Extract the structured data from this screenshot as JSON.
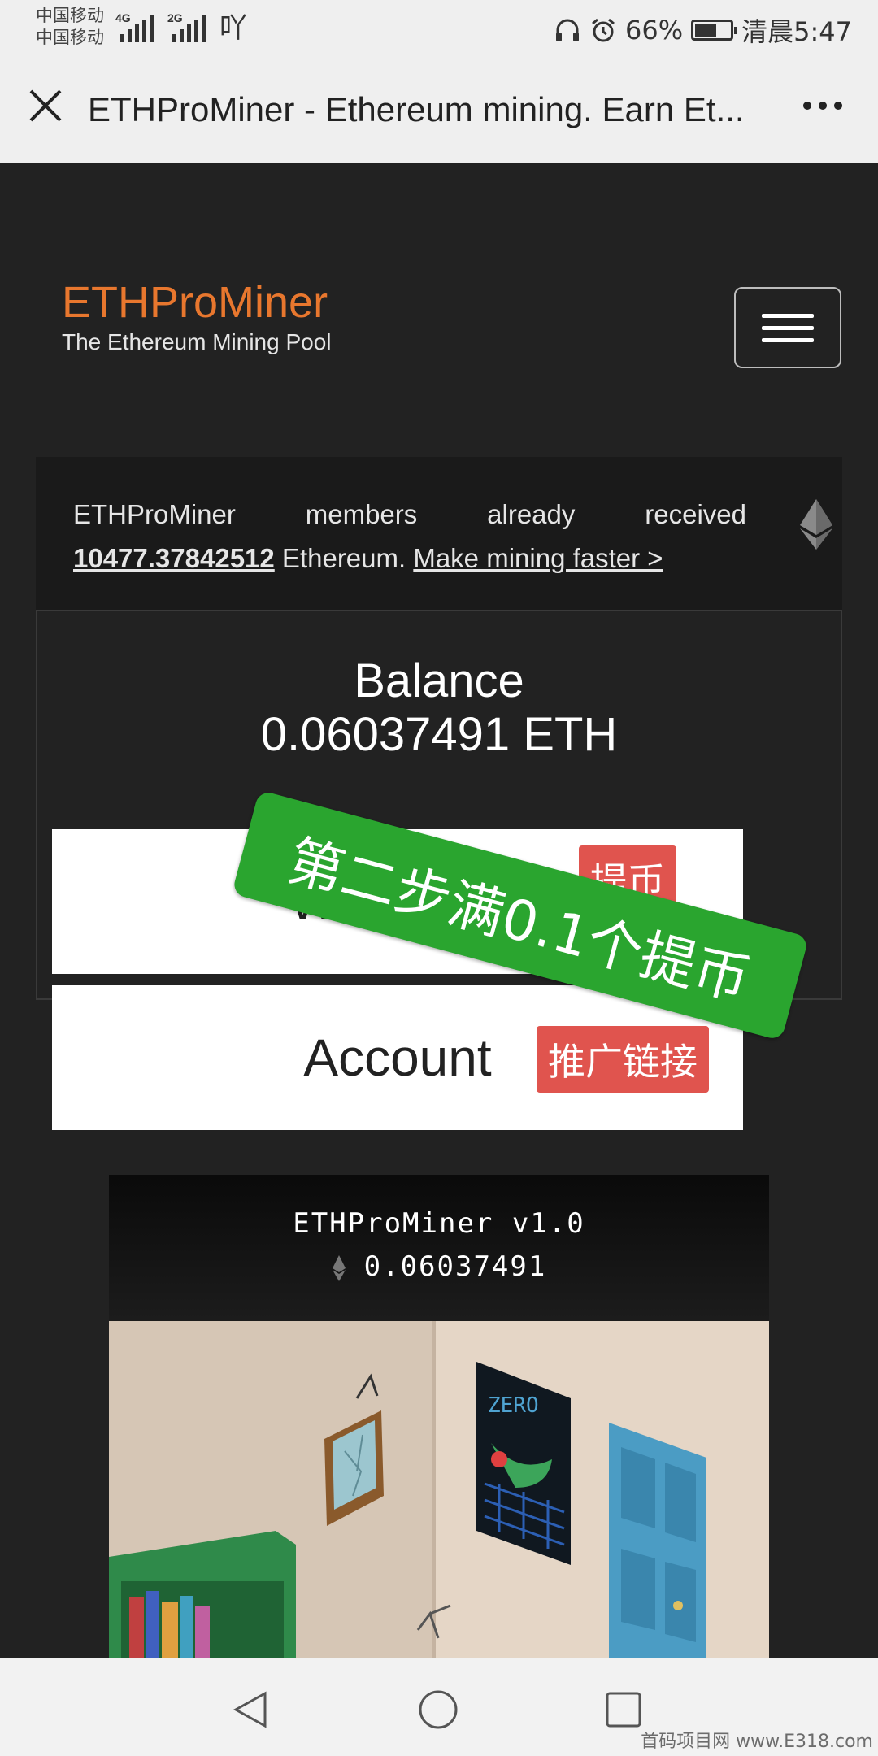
{
  "status_bar": {
    "carrier_1": "中国移动",
    "carrier_2": "中国移动",
    "network_1": "4G",
    "network_2": "2G",
    "hear_icon_glyph": "吖",
    "battery_percent": "66%",
    "battery_level": 0.66,
    "time": "清晨5:47"
  },
  "browser_bar": {
    "title": "ETHProMiner - Ethereum mining. Earn Et..."
  },
  "site_header": {
    "brand": "ETHProMiner",
    "tagline": "The Ethereum Mining Pool"
  },
  "notice": {
    "word_1": "ETHProMiner",
    "word_2": "members",
    "word_3": "already",
    "word_4": "received",
    "amount": "10477.37842512",
    "unit": " Ethereum. ",
    "link": "Make mining faster >"
  },
  "balance": {
    "label": "Balance",
    "value": "0.06037491 ETH"
  },
  "buttons": {
    "withdraw": "Withdraw",
    "account": "Account"
  },
  "overlays": {
    "withdraw_tag": "提币",
    "account_tag": "推广链接",
    "green_banner": "第二步满0.1个提币"
  },
  "game": {
    "title": "ETHProMiner v1.0",
    "balance": "0.06037491"
  },
  "watermark": "首码项目网 www.E318.com",
  "colors": {
    "brand": "#e8772e",
    "page_bg": "#222222",
    "banner_green": "#2aa52f",
    "tag_red": "#e0544e"
  },
  "icons": {
    "close": "close-icon",
    "more": "more-dots-icon",
    "menu": "hamburger-menu-icon",
    "eth": "ethereum-icon",
    "back": "back-triangle-icon",
    "home": "home-circle-icon",
    "recents": "recents-square-icon"
  }
}
